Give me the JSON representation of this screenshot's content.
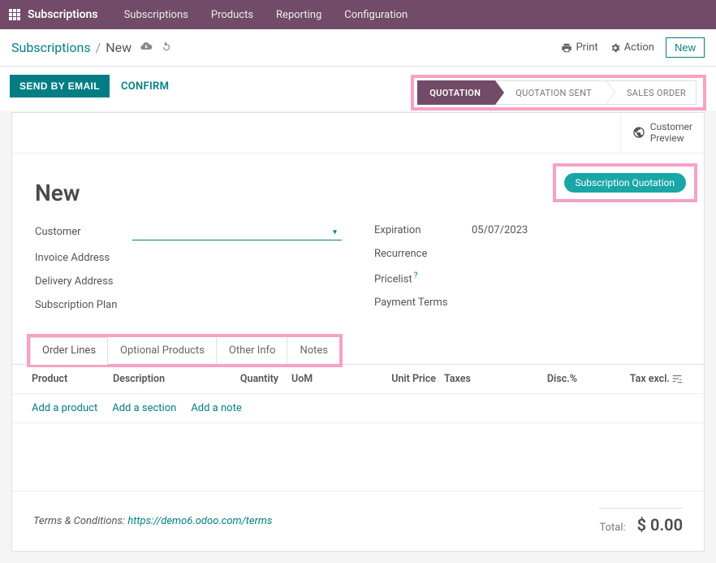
{
  "topbar": {
    "brand": "Subscriptions",
    "menu": [
      "Subscriptions",
      "Products",
      "Reporting",
      "Configuration"
    ]
  },
  "breadcrumb": {
    "root": "Subscriptions",
    "current": "New"
  },
  "toolbar": {
    "print": "Print",
    "action": "Action",
    "new": "New"
  },
  "status_buttons": {
    "send_email": "SEND BY EMAIL",
    "confirm": "CONFIRM"
  },
  "stages": {
    "quotation": "QUOTATION",
    "quotation_sent": "QUOTATION SENT",
    "sales_order": "SALES ORDER"
  },
  "customer_preview": {
    "line1": "Customer",
    "line2": "Preview"
  },
  "badge": "Subscription Quotation",
  "record_title": "New",
  "fields_left": {
    "customer": "Customer",
    "invoice_address": "Invoice Address",
    "delivery_address": "Delivery Address",
    "subscription_plan": "Subscription Plan"
  },
  "fields_right": {
    "expiration": "Expiration",
    "expiration_value": "05/07/2023",
    "recurrence": "Recurrence",
    "pricelist": "Pricelist",
    "payment_terms": "Payment Terms"
  },
  "tabs": {
    "order_lines": "Order Lines",
    "optional_products": "Optional Products",
    "other_info": "Other Info",
    "notes": "Notes"
  },
  "columns": {
    "product": "Product",
    "description": "Description",
    "quantity": "Quantity",
    "uom": "UoM",
    "unit_price": "Unit Price",
    "taxes": "Taxes",
    "disc": "Disc.%",
    "tax_excl": "Tax excl."
  },
  "line_actions": {
    "add_product": "Add a product",
    "add_section": "Add a section",
    "add_note": "Add a note"
  },
  "terms": {
    "label": "Terms & Conditions: ",
    "link": "https://demo6.odoo.com/terms"
  },
  "totals": {
    "label": "Total:",
    "value": "$ 0.00"
  }
}
